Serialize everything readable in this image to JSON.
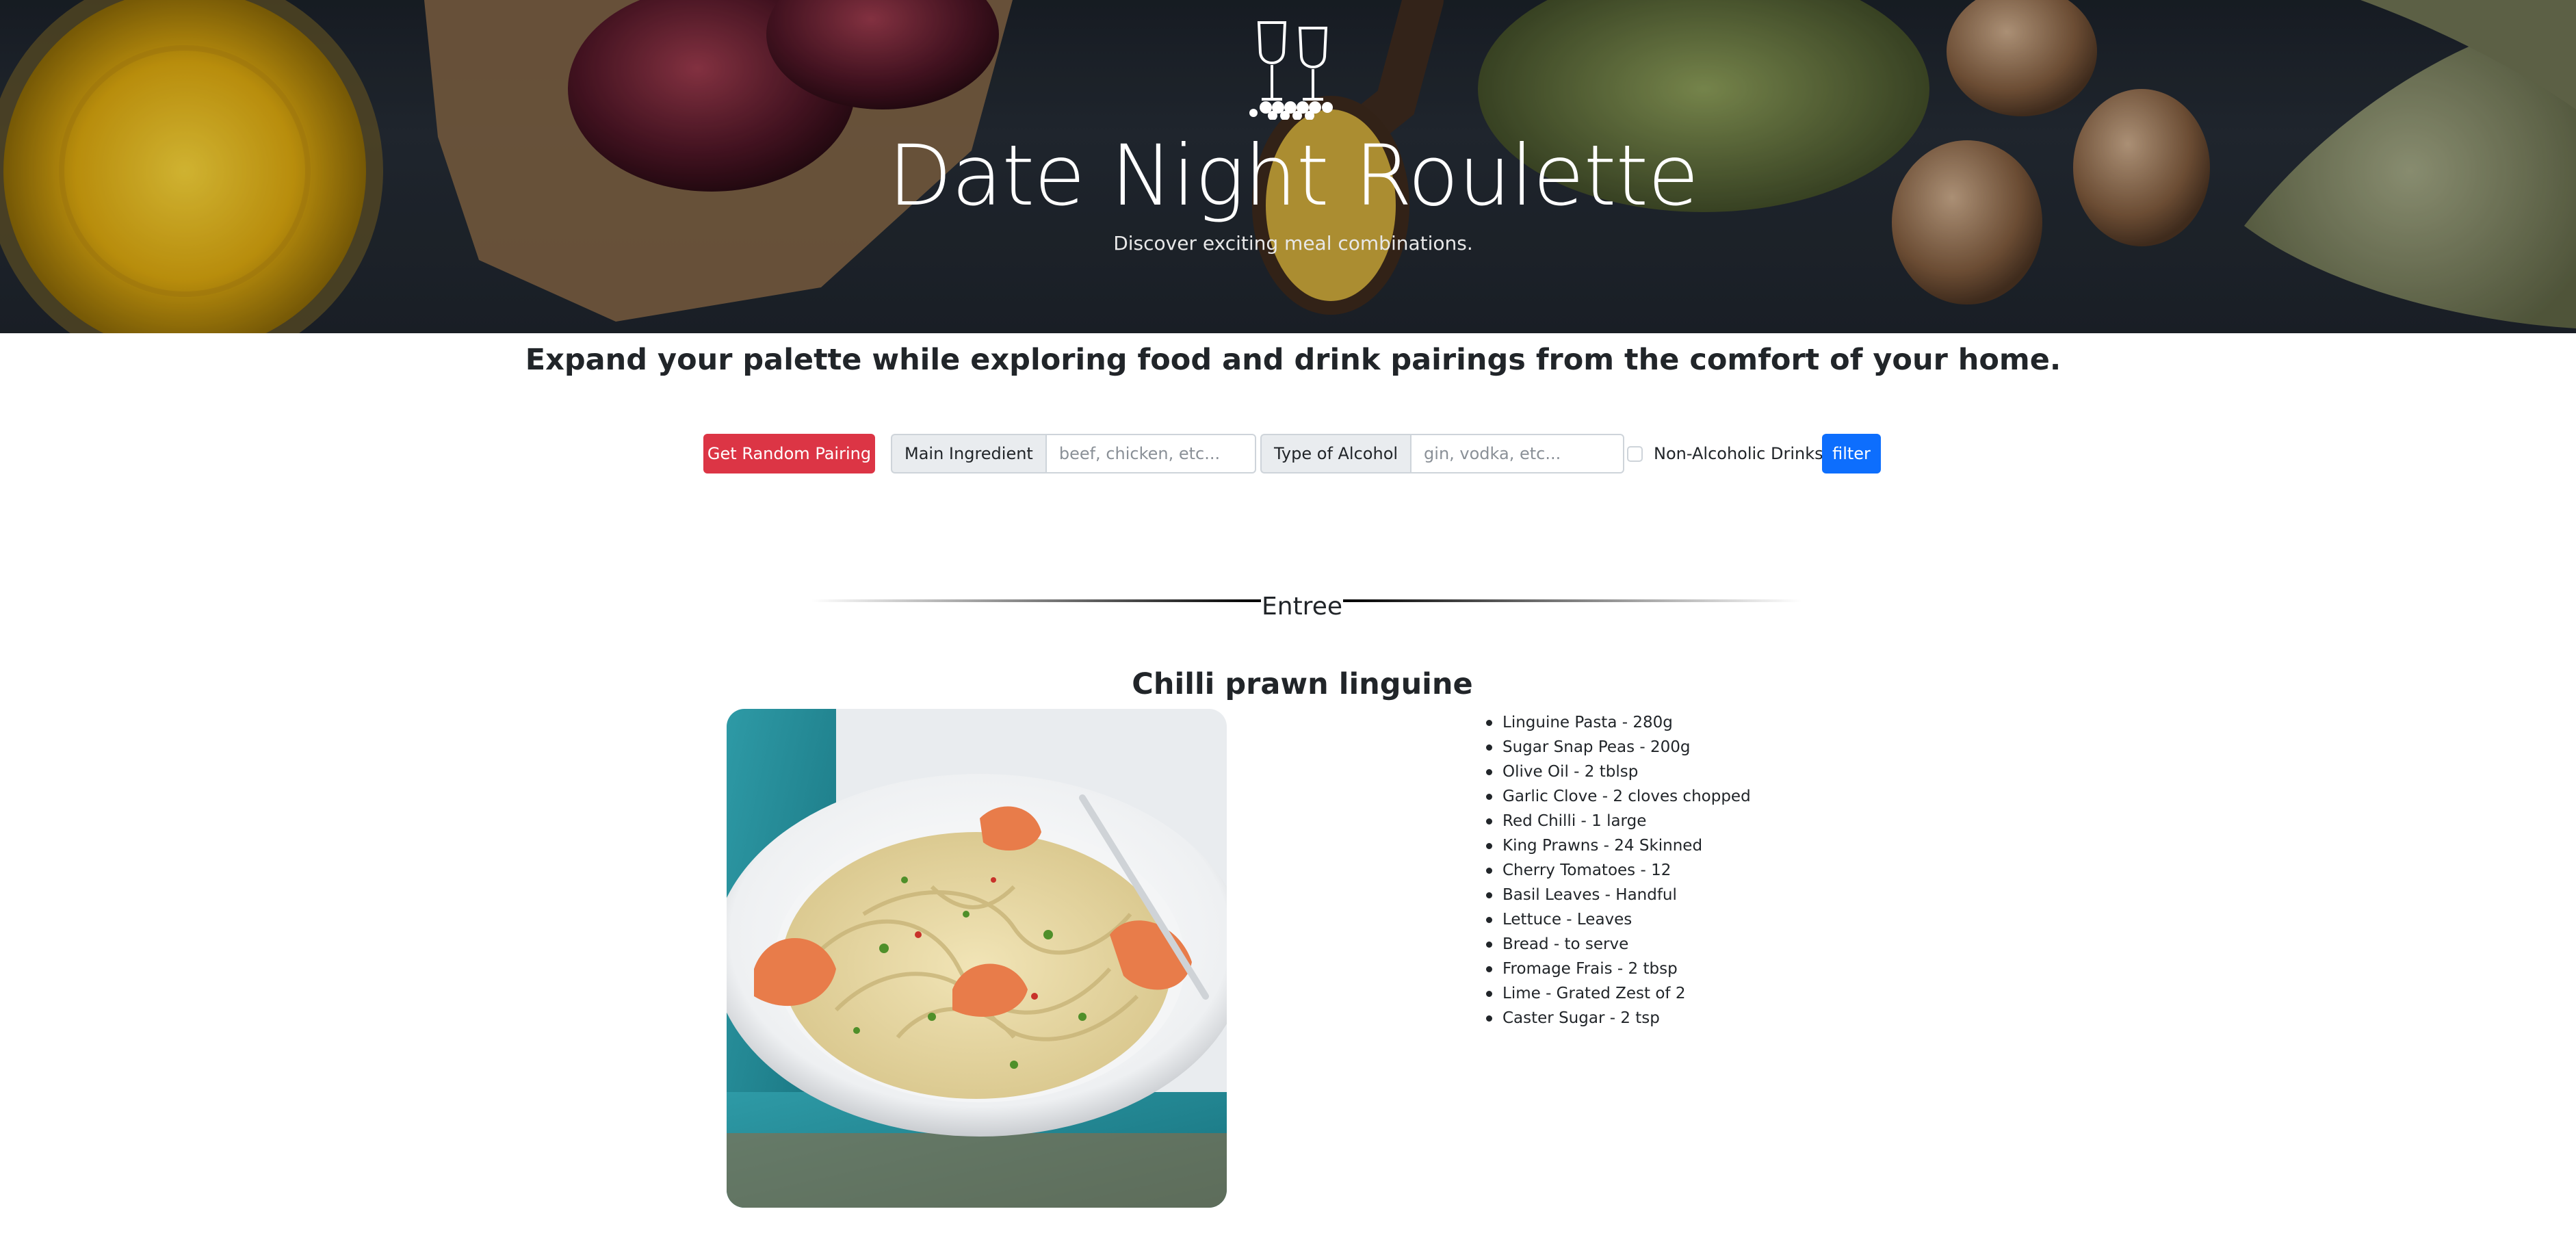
{
  "hero": {
    "title": "Date Night Roulette",
    "subtitle": "Discover exciting meal combinations.",
    "logo_icon": "wine-glasses-grapes-icon"
  },
  "tagline": "Expand your palette while exploring food and drink pairings from the comfort of your home.",
  "controls": {
    "random_button_label": "Get Random Pairing",
    "main_ingredient_label": "Main Ingredient",
    "main_ingredient_placeholder": "beef, chicken, etc...",
    "main_ingredient_value": "",
    "alcohol_label": "Type of Alcohol",
    "alcohol_placeholder": "gin, vodka, etc...",
    "alcohol_value": "",
    "non_alcoholic_label": "Non-Alcoholic Drinks",
    "non_alcoholic_checked": false,
    "filter_button_label": "filter"
  },
  "section": {
    "title": "Entree"
  },
  "dish": {
    "name": "Chilli prawn linguine",
    "ingredients": [
      "Linguine Pasta - 280g",
      "Sugar Snap Peas - 200g",
      "Olive Oil - 2 tblsp",
      "Garlic Clove - 2 cloves chopped",
      "Red Chilli - 1 large",
      "King Prawns - 24 Skinned",
      "Cherry Tomatoes - 12",
      "Basil Leaves - Handful",
      "Lettuce - Leaves",
      "Bread - to serve",
      "Fromage Frais - 2 tbsp",
      "Lime - Grated Zest of 2",
      "Caster Sugar - 2 tsp"
    ]
  },
  "colors": {
    "danger": "#dc3545",
    "primary": "#0d6efd",
    "hero_background": "#20262e"
  }
}
